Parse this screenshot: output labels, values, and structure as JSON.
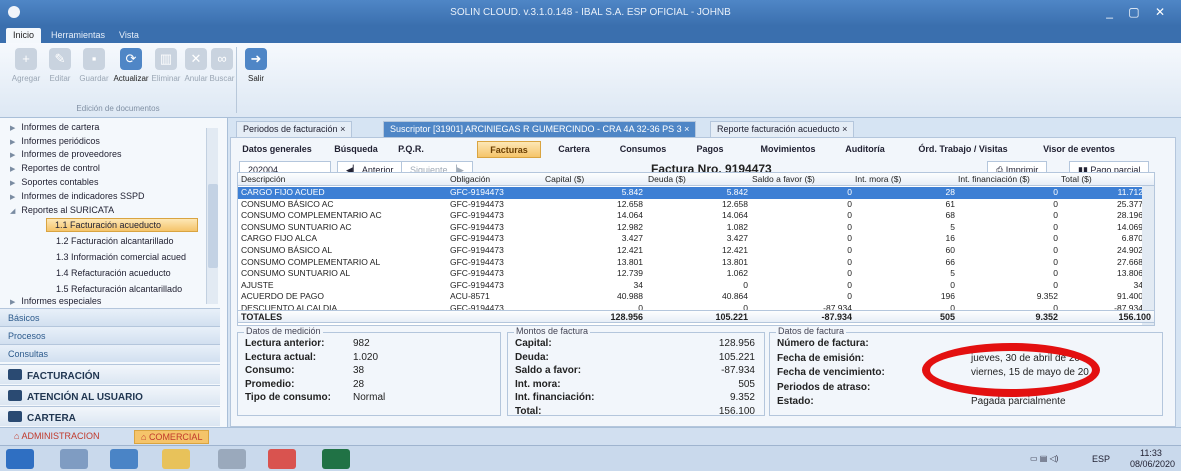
{
  "window": {
    "title": "SOLIN CLOUD. v.3.1.0.148 - IBAL S.A. ESP OFICIAL - JOHNB",
    "controls": "_ ▢ ✕"
  },
  "menu": [
    "Inicio",
    "Herramientas",
    "Vista"
  ],
  "ribbon": {
    "buttons": [
      "Agregar",
      "Editar",
      "Guardar",
      "Actualizar",
      "Eliminar",
      "Anular",
      "Buscar",
      "Salir"
    ],
    "group": "Edición de documentos"
  },
  "nav": {
    "items": [
      "Informes de cartera",
      "Informes periódicos",
      "Informes de proveedores",
      "Reportes de control",
      "Soportes contables",
      "Informes de indicadores SSPD",
      "Reportes al SURICATA"
    ],
    "sub": [
      "1.1 Facturación acueducto",
      "1.2 Facturación alcantarillado",
      "1.3 Información comercial acued",
      "1.4 Refacturación acueducto",
      "1.5 Refacturación alcantarillado"
    ],
    "special": "Informes especiales",
    "sections": [
      "Básicos",
      "Procesos",
      "Consultas"
    ],
    "modules": [
      "FACTURACIÓN",
      "ATENCIÓN AL USUARIO",
      "CARTERA"
    ]
  },
  "footer": [
    "ADMINISTRACION",
    "COMERCIAL"
  ],
  "doctabs": [
    "Periodos de facturación",
    "Suscriptor [31901] ARCINIEGAS R GUMERCINDO - CRA 4A 32-36 PS 3",
    "Reporte facturación acueducto"
  ],
  "subtabs": [
    "Datos generales",
    "Búsqueda",
    "P.Q.R.",
    "Facturas",
    "Cartera",
    "Consumos",
    "Pagos",
    "Movimientos",
    "Auditoría",
    "Órd. Trabajo / Visitas",
    "Visor de eventos"
  ],
  "toolbar": {
    "period": "202004",
    "prev": "Anterior",
    "next": "Siguiente",
    "invoice_title": "Factura Nro. 9194473",
    "print": "Imprimir",
    "partial": "Pago parcial"
  },
  "table": {
    "headers": [
      "Descripción",
      "Obligación",
      "Capital ($)",
      "Deuda ($)",
      "Saldo a favor ($)",
      "Int. mora ($)",
      "Int. financiación ($)",
      "Total ($)"
    ],
    "rows": [
      [
        "CARGO FIJO ACUED",
        "GFC-9194473",
        "5.842",
        "5.842",
        "0",
        "28",
        "0",
        "11.712"
      ],
      [
        "CONSUMO BÁSICO AC",
        "GFC-9194473",
        "12.658",
        "12.658",
        "0",
        "61",
        "0",
        "25.377"
      ],
      [
        "CONSUMO COMPLEMENTARIO AC",
        "GFC-9194473",
        "14.064",
        "14.064",
        "0",
        "68",
        "0",
        "28.196"
      ],
      [
        "CONSUMO SUNTUARIO AC",
        "GFC-9194473",
        "12.982",
        "1.082",
        "0",
        "5",
        "0",
        "14.069"
      ],
      [
        "CARGO FIJO ALCA",
        "GFC-9194473",
        "3.427",
        "3.427",
        "0",
        "16",
        "0",
        "6.870"
      ],
      [
        "CONSUMO BÁSICO AL",
        "GFC-9194473",
        "12.421",
        "12.421",
        "0",
        "60",
        "0",
        "24.902"
      ],
      [
        "CONSUMO COMPLEMENTARIO AL",
        "GFC-9194473",
        "13.801",
        "13.801",
        "0",
        "66",
        "0",
        "27.668"
      ],
      [
        "CONSUMO SUNTUARIO AL",
        "GFC-9194473",
        "12.739",
        "1.062",
        "0",
        "5",
        "0",
        "13.806"
      ],
      [
        "AJUSTE",
        "GFC-9194473",
        "34",
        "0",
        "0",
        "0",
        "0",
        "34"
      ],
      [
        "ACUERDO DE PAGO",
        "ACU-8571",
        "40.988",
        "40.864",
        "0",
        "196",
        "9.352",
        "91.400"
      ],
      [
        "DESCUENTO ALCALDIA",
        "GFC-9194473",
        "0",
        "0",
        "-87.934",
        "0",
        "0",
        "-87.934"
      ]
    ],
    "totals": [
      "TOTALES",
      "128.956",
      "105.221",
      "-87.934",
      "505",
      "9.352",
      "156.100"
    ]
  },
  "medicion": {
    "legend": "Datos de medición",
    "labels": [
      "Lectura anterior:",
      "Lectura actual:",
      "Consumo:",
      "Promedio:",
      "Tipo de consumo:"
    ],
    "values": [
      "982",
      "1.020",
      "38",
      "28",
      "Normal"
    ]
  },
  "montos": {
    "legend": "Montos de factura",
    "labels": [
      "Capital:",
      "Deuda:",
      "Saldo a favor:",
      "Int. mora:",
      "Int. financiación:",
      "Total:"
    ],
    "values": [
      "128.956",
      "105.221",
      "-87.934",
      "505",
      "9.352",
      "156.100"
    ]
  },
  "datos": {
    "legend": "Datos de factura",
    "labels": [
      "Número de factura:",
      "Fecha de emisión:",
      "Fecha de vencimiento:",
      "Periodos de atraso:",
      "Estado:"
    ],
    "values": [
      "",
      "jueves, 30 de abril de 20",
      "viernes, 15 de mayo de 20",
      "",
      "Pagada parcialmente"
    ]
  },
  "tray": {
    "lang": "ESP",
    "time": "11:33",
    "date": "08/06/2020"
  }
}
